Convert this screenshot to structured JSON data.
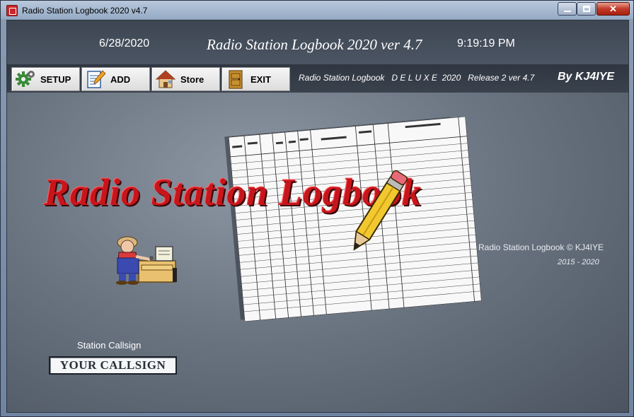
{
  "window": {
    "title": "Radio Station Logbook 2020 v4.7",
    "controls": {
      "minimize": "▬",
      "maximize": "❐",
      "close": "✕"
    }
  },
  "header": {
    "date": "6/28/2020",
    "title": "Radio Station Logbook 2020 ver 4.7",
    "time": "9:19:19 PM"
  },
  "toolbar": {
    "buttons": [
      {
        "label": "SETUP",
        "icon": "gear-icon"
      },
      {
        "label": "ADD",
        "icon": "notepad-pencil-icon"
      },
      {
        "label": "Store",
        "icon": "house-icon"
      },
      {
        "label": "EXIT",
        "icon": "door-icon"
      }
    ],
    "caption": "Radio Station Logbook   D E L U X E  2020   Release 2 ver 4.7",
    "author": "By KJ4IYE"
  },
  "main": {
    "logo_text": "Radio Station Logbook",
    "copyright": "Radio Station Logbook © KJ4IYE",
    "years": "2015 - 2020",
    "callsign_label": "Station Callsign",
    "callsign_value": "YOUR CALLSIGN"
  },
  "colors": {
    "logo_red": "#c8151c",
    "close_red": "#c23a28",
    "header_dark": "#3d4652"
  }
}
